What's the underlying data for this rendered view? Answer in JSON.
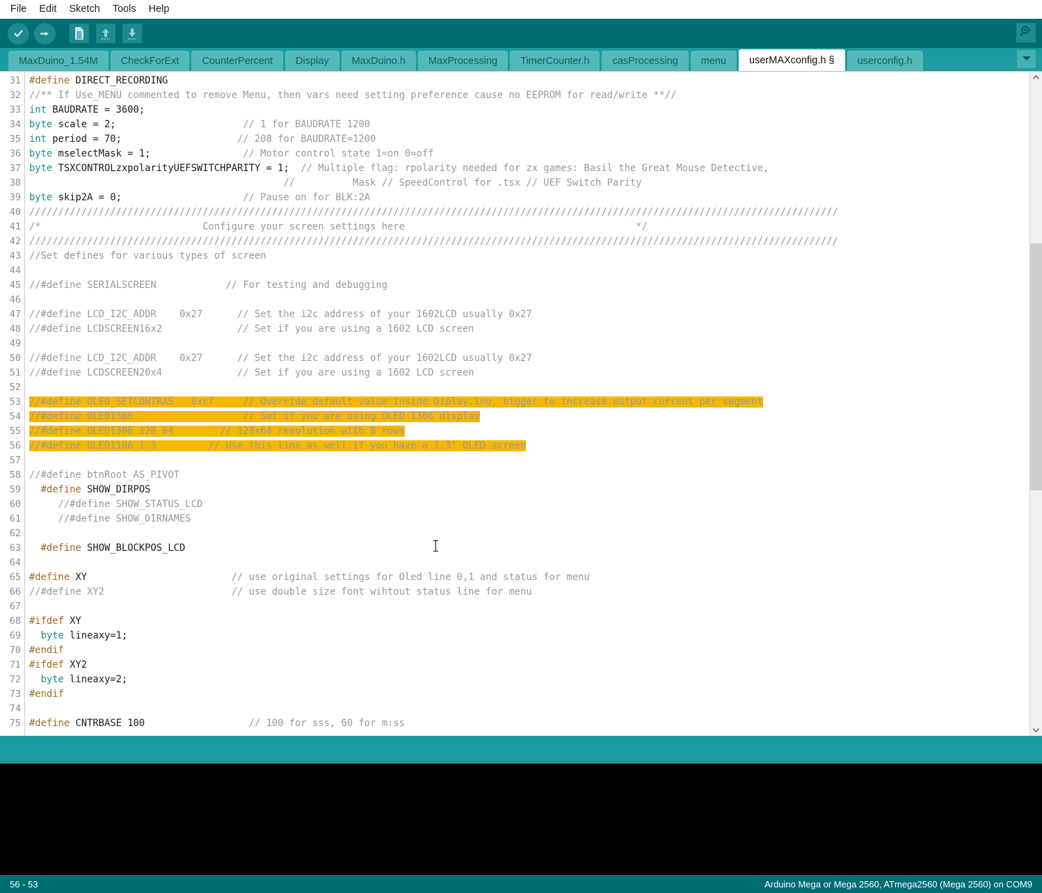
{
  "menubar": {
    "items": [
      "File",
      "Edit",
      "Sketch",
      "Tools",
      "Help"
    ]
  },
  "toolbar": {
    "verify_label": "Verify",
    "upload_label": "Upload",
    "new_label": "New",
    "open_label": "Open",
    "save_label": "Save",
    "serial_monitor_label": "Serial Monitor"
  },
  "tabs": {
    "items": [
      {
        "label": "MaxDuino_1.54M",
        "active": false
      },
      {
        "label": "CheckForExt",
        "active": false
      },
      {
        "label": "CounterPercent",
        "active": false
      },
      {
        "label": "Display",
        "active": false
      },
      {
        "label": "MaxDuino.h",
        "active": false
      },
      {
        "label": "MaxProcessing",
        "active": false
      },
      {
        "label": "TimerCounter.h",
        "active": false
      },
      {
        "label": "casProcessing",
        "active": false
      },
      {
        "label": "menu",
        "active": false
      },
      {
        "label": "userMAXconfig.h §",
        "active": true
      },
      {
        "label": "userconfig.h",
        "active": false
      }
    ],
    "dropdown_label": "More tabs"
  },
  "editor": {
    "first_line": 31,
    "lines": [
      {
        "n": 31,
        "segs": [
          {
            "t": "#define ",
            "c": "pre"
          },
          {
            "t": "DIRECT_RECORDING",
            "c": "plain"
          }
        ]
      },
      {
        "n": 32,
        "segs": [
          {
            "t": "//** If Use_MENU commented to remove Menu, then vars need setting preference cause no EEPROM for read/write **//",
            "c": "com"
          }
        ]
      },
      {
        "n": 33,
        "segs": [
          {
            "t": "int",
            "c": "type"
          },
          {
            "t": " BAUDRATE = 3600;",
            "c": "plain"
          }
        ]
      },
      {
        "n": 34,
        "segs": [
          {
            "t": "byte",
            "c": "type"
          },
          {
            "t": " scale = 2;                      ",
            "c": "plain"
          },
          {
            "t": "// 1 for BAUDRATE 1200",
            "c": "com"
          }
        ]
      },
      {
        "n": 35,
        "segs": [
          {
            "t": "int",
            "c": "type"
          },
          {
            "t": " period = 70;                    ",
            "c": "plain"
          },
          {
            "t": "// 208 for BAUDRATE=1200",
            "c": "com"
          }
        ]
      },
      {
        "n": 36,
        "segs": [
          {
            "t": "byte",
            "c": "type"
          },
          {
            "t": " mselectMask = 1;                ",
            "c": "plain"
          },
          {
            "t": "// Motor control state 1=on 0=off",
            "c": "com"
          }
        ]
      },
      {
        "n": 37,
        "segs": [
          {
            "t": "byte",
            "c": "type"
          },
          {
            "t": " TSXCONTROLzxpolarityUEFSWITCHPARITY = 1;  ",
            "c": "plain"
          },
          {
            "t": "// Multiple flag: rpolarity needed for zx games: Basil the Great Mouse Detective,",
            "c": "com"
          }
        ]
      },
      {
        "n": 38,
        "segs": [
          {
            "t": "                                            ",
            "c": "plain"
          },
          {
            "t": "//          Mask // SpeedControl for .tsx // UEF Switch Parity",
            "c": "com"
          }
        ]
      },
      {
        "n": 39,
        "segs": [
          {
            "t": "byte",
            "c": "type"
          },
          {
            "t": " skip2A = 0;                     ",
            "c": "plain"
          },
          {
            "t": "// Pause on for BLK:2A",
            "c": "com"
          }
        ]
      },
      {
        "n": 40,
        "segs": [
          {
            "t": "////////////////////////////////////////////////////////////////////////////////////////////////////////////////////////////////////////////",
            "c": "com"
          }
        ]
      },
      {
        "n": 41,
        "segs": [
          {
            "t": "/*                            Configure your screen settings here                                        */",
            "c": "com"
          }
        ]
      },
      {
        "n": 42,
        "segs": [
          {
            "t": "////////////////////////////////////////////////////////////////////////////////////////////////////////////////////////////////////////////",
            "c": "com"
          }
        ]
      },
      {
        "n": 43,
        "segs": [
          {
            "t": "//Set defines for various types of screen",
            "c": "com"
          }
        ]
      },
      {
        "n": 44,
        "segs": []
      },
      {
        "n": 45,
        "segs": [
          {
            "t": "//#define SERIALSCREEN            ",
            "c": "com"
          },
          {
            "t": "// For testing and debugging",
            "c": "com"
          }
        ]
      },
      {
        "n": 46,
        "segs": []
      },
      {
        "n": 47,
        "segs": [
          {
            "t": "//#define LCD_I2C_ADDR    0x27      ",
            "c": "com"
          },
          {
            "t": "// Set the i2c address of your 1602LCD usually 0x27",
            "c": "com"
          }
        ]
      },
      {
        "n": 48,
        "segs": [
          {
            "t": "//#define LCDSCREEN16x2             ",
            "c": "com"
          },
          {
            "t": "// Set if you are using a 1602 LCD screen",
            "c": "com"
          }
        ]
      },
      {
        "n": 49,
        "segs": []
      },
      {
        "n": 50,
        "segs": [
          {
            "t": "//#define LCD_I2C_ADDR    0x27      ",
            "c": "com"
          },
          {
            "t": "// Set the i2c address of your 1602LCD usually 0x27",
            "c": "com"
          }
        ]
      },
      {
        "n": 51,
        "segs": [
          {
            "t": "//#define LCDSCREEN20x4             ",
            "c": "com"
          },
          {
            "t": "// Set if you are using a 1602 LCD screen",
            "c": "com"
          }
        ]
      },
      {
        "n": 52,
        "segs": []
      },
      {
        "n": 53,
        "highlight": true,
        "segs": [
          {
            "t": "//#define OLED_SETCONTRAS   0xcf     // Override default value inside Diplay.ino, bigger to increase output current per segment",
            "c": "com"
          }
        ]
      },
      {
        "n": 54,
        "highlight": true,
        "segs": [
          {
            "t": "//#define OLED1306                   // Set if you are using OLED 1306 display",
            "c": "com"
          }
        ]
      },
      {
        "n": 55,
        "highlight": true,
        "segs": [
          {
            "t": "//#define OLED1306_128_64        // 128x64 resolution with 8 rows",
            "c": "com"
          }
        ]
      },
      {
        "n": 56,
        "highlight": true,
        "segs": [
          {
            "t": "//#define OLED1106_1_3         // Use this line as well if you have a 1.3\" OLED screen",
            "c": "com"
          }
        ]
      },
      {
        "n": 57,
        "segs": []
      },
      {
        "n": 58,
        "segs": [
          {
            "t": "//#define btnRoot_AS_PIVOT",
            "c": "com"
          }
        ]
      },
      {
        "n": 59,
        "segs": [
          {
            "t": "  #define ",
            "c": "pre"
          },
          {
            "t": "SHOW_DIRPOS",
            "c": "plain"
          }
        ]
      },
      {
        "n": 60,
        "segs": [
          {
            "t": "     //#define SHOW_STATUS_LCD",
            "c": "com"
          }
        ]
      },
      {
        "n": 61,
        "segs": [
          {
            "t": "     //#define SHOW_DIRNAMES",
            "c": "com"
          }
        ]
      },
      {
        "n": 62,
        "segs": []
      },
      {
        "n": 63,
        "segs": [
          {
            "t": "  #define ",
            "c": "pre"
          },
          {
            "t": "SHOW_BLOCKPOS_LCD",
            "c": "plain"
          }
        ]
      },
      {
        "n": 64,
        "segs": []
      },
      {
        "n": 65,
        "segs": [
          {
            "t": "#define ",
            "c": "pre"
          },
          {
            "t": "XY                         ",
            "c": "plain"
          },
          {
            "t": "// use original settings for Oled line 0,1 and status for menu",
            "c": "com"
          }
        ]
      },
      {
        "n": 66,
        "segs": [
          {
            "t": "//#define XY2                      ",
            "c": "com"
          },
          {
            "t": "// use double size font wihtout status line for menu",
            "c": "com"
          }
        ]
      },
      {
        "n": 67,
        "segs": []
      },
      {
        "n": 68,
        "segs": [
          {
            "t": "#ifdef ",
            "c": "pre"
          },
          {
            "t": "XY",
            "c": "plain"
          }
        ]
      },
      {
        "n": 69,
        "segs": [
          {
            "t": "  ",
            "c": "plain"
          },
          {
            "t": "byte",
            "c": "type"
          },
          {
            "t": " lineaxy=1;",
            "c": "plain"
          }
        ]
      },
      {
        "n": 70,
        "segs": [
          {
            "t": "#endif",
            "c": "pre"
          }
        ]
      },
      {
        "n": 71,
        "segs": [
          {
            "t": "#ifdef ",
            "c": "pre"
          },
          {
            "t": "XY2",
            "c": "plain"
          }
        ]
      },
      {
        "n": 72,
        "segs": [
          {
            "t": "  ",
            "c": "plain"
          },
          {
            "t": "byte",
            "c": "type"
          },
          {
            "t": " lineaxy=2;",
            "c": "plain"
          }
        ]
      },
      {
        "n": 73,
        "segs": [
          {
            "t": "#endif",
            "c": "pre"
          }
        ]
      },
      {
        "n": 74,
        "segs": []
      },
      {
        "n": 75,
        "segs": [
          {
            "t": "#define ",
            "c": "pre"
          },
          {
            "t": "CNTRBASE 100                  ",
            "c": "plain"
          },
          {
            "t": "// 100 for sss, 60 for m:ss",
            "c": "com"
          }
        ]
      }
    ],
    "scrollbar": {
      "up_label": "Scroll up",
      "down_label": "Scroll down",
      "thumb_label": "Vertical scroll thumb"
    }
  },
  "statusbar": {
    "cursor_position": "56 - 53",
    "board_info": "Arduino Mega or Mega 2560, ATmega2560 (Mega 2560) on COM9"
  },
  "colors": {
    "toolbar_bg": "#006d73",
    "tabbar_bg": "#1c9ba0",
    "tab_bg": "#55b9bc",
    "highlight": "#f5b800",
    "preprocessor": "#a06820",
    "type_keyword": "#1a8b8f",
    "comment": "#969a9a"
  }
}
